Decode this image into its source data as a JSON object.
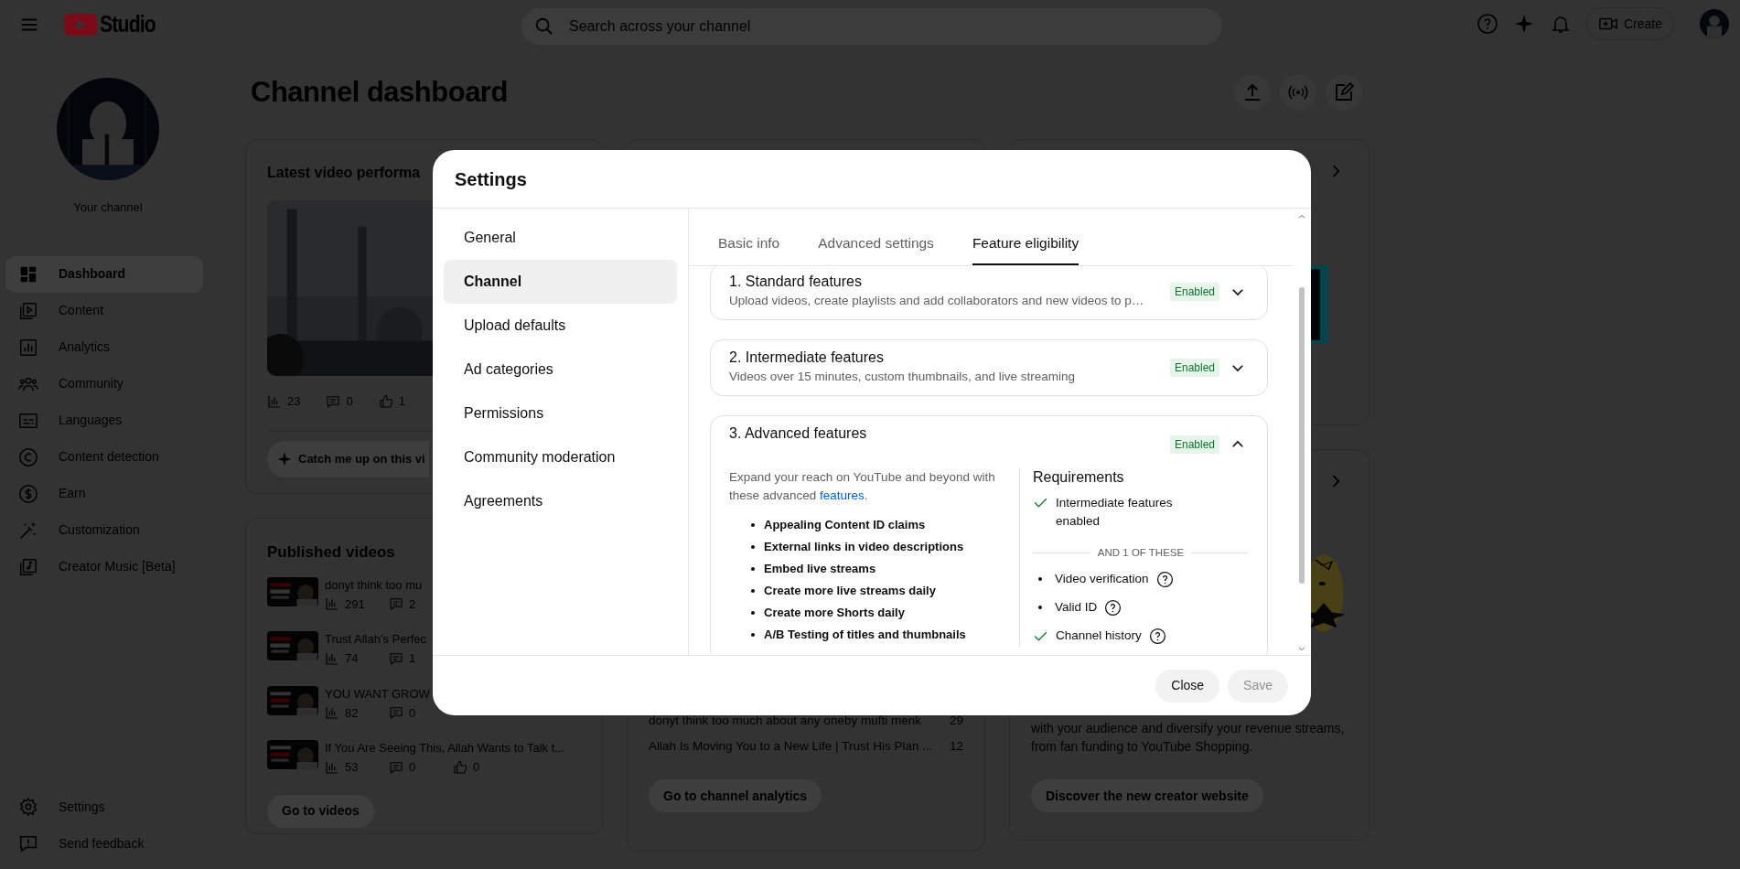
{
  "topbar": {
    "logo_text": "Studio",
    "search_placeholder": "Search across your channel",
    "create_label": "Create"
  },
  "sidebar": {
    "channel_label": "Your channel",
    "items": [
      {
        "label": "Dashboard",
        "selected": true
      },
      {
        "label": "Content",
        "selected": false
      },
      {
        "label": "Analytics",
        "selected": false
      },
      {
        "label": "Community",
        "selected": false
      },
      {
        "label": "Languages",
        "selected": false
      },
      {
        "label": "Content detection",
        "selected": false
      },
      {
        "label": "Earn",
        "selected": false
      },
      {
        "label": "Customization",
        "selected": false
      },
      {
        "label": "Creator Music [Beta]",
        "selected": false
      }
    ],
    "footer_items": [
      "Settings",
      "Send feedback"
    ]
  },
  "page_title": "Channel dashboard",
  "latest_video_card": {
    "title": "Latest video performa",
    "stats": [
      "23",
      "0",
      "1"
    ],
    "ai_button": "Catch me up on this vi"
  },
  "published_card": {
    "title": "Published videos",
    "videos": [
      {
        "title": "donyt think too mu",
        "stats": [
          "291",
          "2"
        ]
      },
      {
        "title": "Trust Allah's Perfec",
        "stats": [
          "74",
          "1"
        ]
      },
      {
        "title": "YOU WANT GROW",
        "stats": [
          "82",
          "0"
        ]
      },
      {
        "title": "If You Are Seeing This, Allah Wants to Talk t...",
        "stats": [
          "53",
          "0",
          "0"
        ]
      }
    ],
    "button": "Go to videos"
  },
  "analytics_card": {
    "rows": [
      {
        "title": "donyt think too much about any oneby mufti menk",
        "value": "29"
      },
      {
        "title": "Allah Is Moving You to a New Life | Trust His Plan ...",
        "value": "12"
      }
    ],
    "button": "Go to channel analytics"
  },
  "creator_card": {
    "text": "with your audience and diversify your revenue streams, from fan funding to YouTube Shopping.",
    "button": "Discover the new creator website"
  },
  "dialog": {
    "title": "Settings",
    "nav": [
      {
        "label": "General",
        "selected": false
      },
      {
        "label": "Channel",
        "selected": true
      },
      {
        "label": "Upload defaults",
        "selected": false
      },
      {
        "label": "Ad categories",
        "selected": false
      },
      {
        "label": "Permissions",
        "selected": false
      },
      {
        "label": "Community moderation",
        "selected": false
      },
      {
        "label": "Agreements",
        "selected": false
      }
    ],
    "tabs": [
      {
        "label": "Basic info",
        "selected": false
      },
      {
        "label": "Advanced settings",
        "selected": false
      },
      {
        "label": "Feature eligibility",
        "selected": true
      }
    ],
    "features": [
      {
        "title": "1. Standard features",
        "description": "Upload videos, create playlists and add collaborators and new videos to p…",
        "status": "Enabled",
        "expanded": false
      },
      {
        "title": "2. Intermediate features",
        "description": "Videos over 15 minutes, custom thumbnails, and live streaming",
        "status": "Enabled",
        "expanded": false
      },
      {
        "title": "3. Advanced features",
        "status": "Enabled",
        "expanded": true,
        "intro": "Expand your reach on YouTube and beyond with these advanced ",
        "intro_link": "features",
        "intro_end": ".",
        "benefits": [
          "Appealing Content ID claims",
          "External links in video descriptions",
          "Embed live streams",
          "Create more live streams daily",
          "Create more Shorts daily",
          "A/B Testing of titles and thumbnails"
        ],
        "requirements_title": "Requirements",
        "requirements": [
          {
            "label": "Intermediate features enabled",
            "met": true
          }
        ],
        "separator": "AND 1 OF THESE",
        "options": [
          {
            "label": "Video verification",
            "met": false
          },
          {
            "label": "Valid ID",
            "met": false
          },
          {
            "label": "Channel history",
            "met": true
          }
        ]
      }
    ],
    "buttons": [
      {
        "label": "Close",
        "disabled": false
      },
      {
        "label": "Save",
        "disabled": true
      }
    ]
  }
}
